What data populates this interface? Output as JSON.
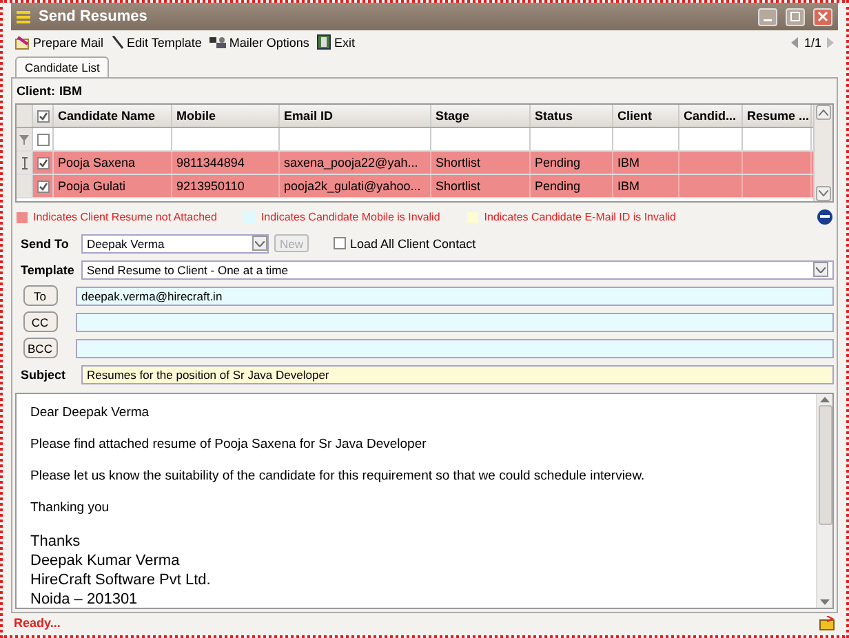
{
  "window": {
    "title": "Send Resumes"
  },
  "toolbar": [
    {
      "label": "Prepare Mail",
      "kind": "mail"
    },
    {
      "label": "Edit Template",
      "kind": "pen"
    },
    {
      "label": "Mailer Options",
      "kind": "options"
    },
    {
      "label": "Exit",
      "kind": "exit"
    }
  ],
  "pager": {
    "text": "1/1"
  },
  "tabs": [
    {
      "label": "Candidate List",
      "selected": true
    }
  ],
  "client": {
    "label": "Client:",
    "value": "IBM"
  },
  "grid": {
    "header_checked": true,
    "filter_checked": false,
    "columns": [
      "Candidate Name",
      "Mobile",
      "Email ID",
      "Stage",
      "Status",
      "Client",
      "Candid...",
      "Resume ..."
    ],
    "rows": [
      {
        "current": true,
        "checked": true,
        "color": "#ef8a8a",
        "cells": [
          "Pooja Saxena",
          "9811344894",
          "saxena_pooja22@yah...",
          "Shortlist",
          "Pending",
          "IBM",
          "",
          ""
        ]
      },
      {
        "current": false,
        "checked": true,
        "color": "#ef8a8a",
        "cells": [
          "Pooja Gulati",
          "9213950110",
          "pooja2k_gulati@yahoo...",
          "Shortlist",
          "Pending",
          "IBM",
          "",
          ""
        ]
      }
    ]
  },
  "legend": [
    {
      "color": "#ef8a8a",
      "text": "Indicates Client Resume not Attached"
    },
    {
      "color": "#dffafd",
      "text": "Indicates Candidate Mobile is Invalid"
    },
    {
      "color": "#fdfbd0",
      "text": "Indicates Candidate E-Mail ID is Invalid"
    }
  ],
  "form": {
    "send_to": {
      "label": "Send To",
      "value": "Deepak Verma"
    },
    "new_button": {
      "label": "New",
      "disabled": true
    },
    "load_all": {
      "label": "Load All Client Contact",
      "checked": false
    },
    "template": {
      "label": "Template",
      "value": "Send Resume to Client - One at a time"
    },
    "recipients": [
      {
        "label": "To",
        "value": "deepak.verma@hirecraft.in"
      },
      {
        "label": "CC"
      },
      {
        "label": "BCC"
      }
    ],
    "subject": {
      "label": "Subject",
      "value": "Resumes for the position of Sr Java Developer"
    }
  },
  "body": {
    "paragraphs": [
      "Dear Deepak Verma",
      "Please find attached resume of Pooja Saxena for Sr Java Developer",
      "Please let us know the suitability of the candidate for this requirement so that we could schedule interview.",
      "Thanking you"
    ],
    "signature": [
      "Thanks",
      "Deepak Kumar Verma",
      "HireCraft Software Pvt Ltd.",
      "Noida – 201301"
    ]
  },
  "status_bar": {
    "text": "Ready..."
  }
}
